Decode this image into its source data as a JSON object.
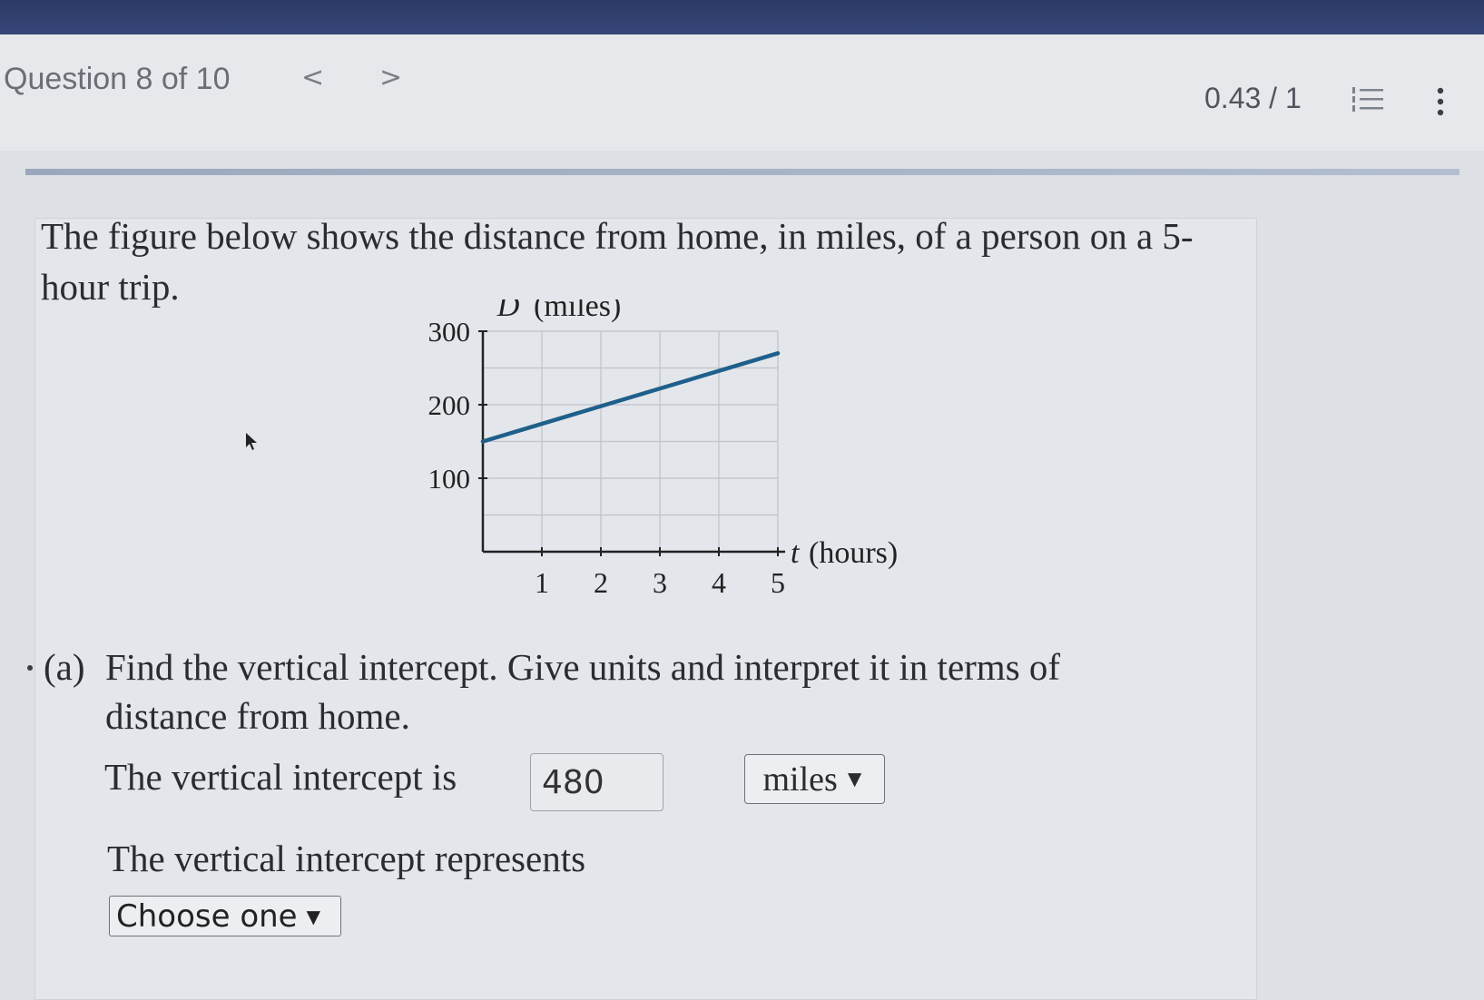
{
  "header": {
    "question_label": "Question 8 of 10",
    "prev_symbol": "<",
    "next_symbol": ">",
    "score": "0.43 / 1",
    "icons": [
      "numbered-list-icon",
      "more-vertical-icon"
    ]
  },
  "question": {
    "intro": "The figure below shows the distance from home, in miles, of a person on a 5-hour trip.",
    "part_a": {
      "letter": "(a)",
      "prompt": "Find the vertical intercept. Give units and interpret it in terms of distance from home.",
      "intercept_label": "The vertical intercept is",
      "intercept_value": "480",
      "units_value": "miles",
      "represents_label": "The vertical intercept represents",
      "represents_value": "Choose one"
    }
  },
  "chart_data": {
    "type": "line",
    "ylabel_var": "D",
    "ylabel_unit": "(miles)",
    "xlabel_var": "t",
    "xlabel_unit": "(hours)",
    "x_ticks": [
      1,
      2,
      3,
      4,
      5
    ],
    "y_ticks": [
      100,
      200,
      300
    ],
    "xlim": [
      0,
      5
    ],
    "ylim": [
      0,
      300
    ],
    "grid": true,
    "series": [
      {
        "x": [
          0,
          5
        ],
        "y": [
          150,
          270
        ]
      }
    ],
    "colors": {
      "line": "#1f5f8b",
      "grid": "#bfc3c9",
      "axis": "#222222"
    }
  }
}
